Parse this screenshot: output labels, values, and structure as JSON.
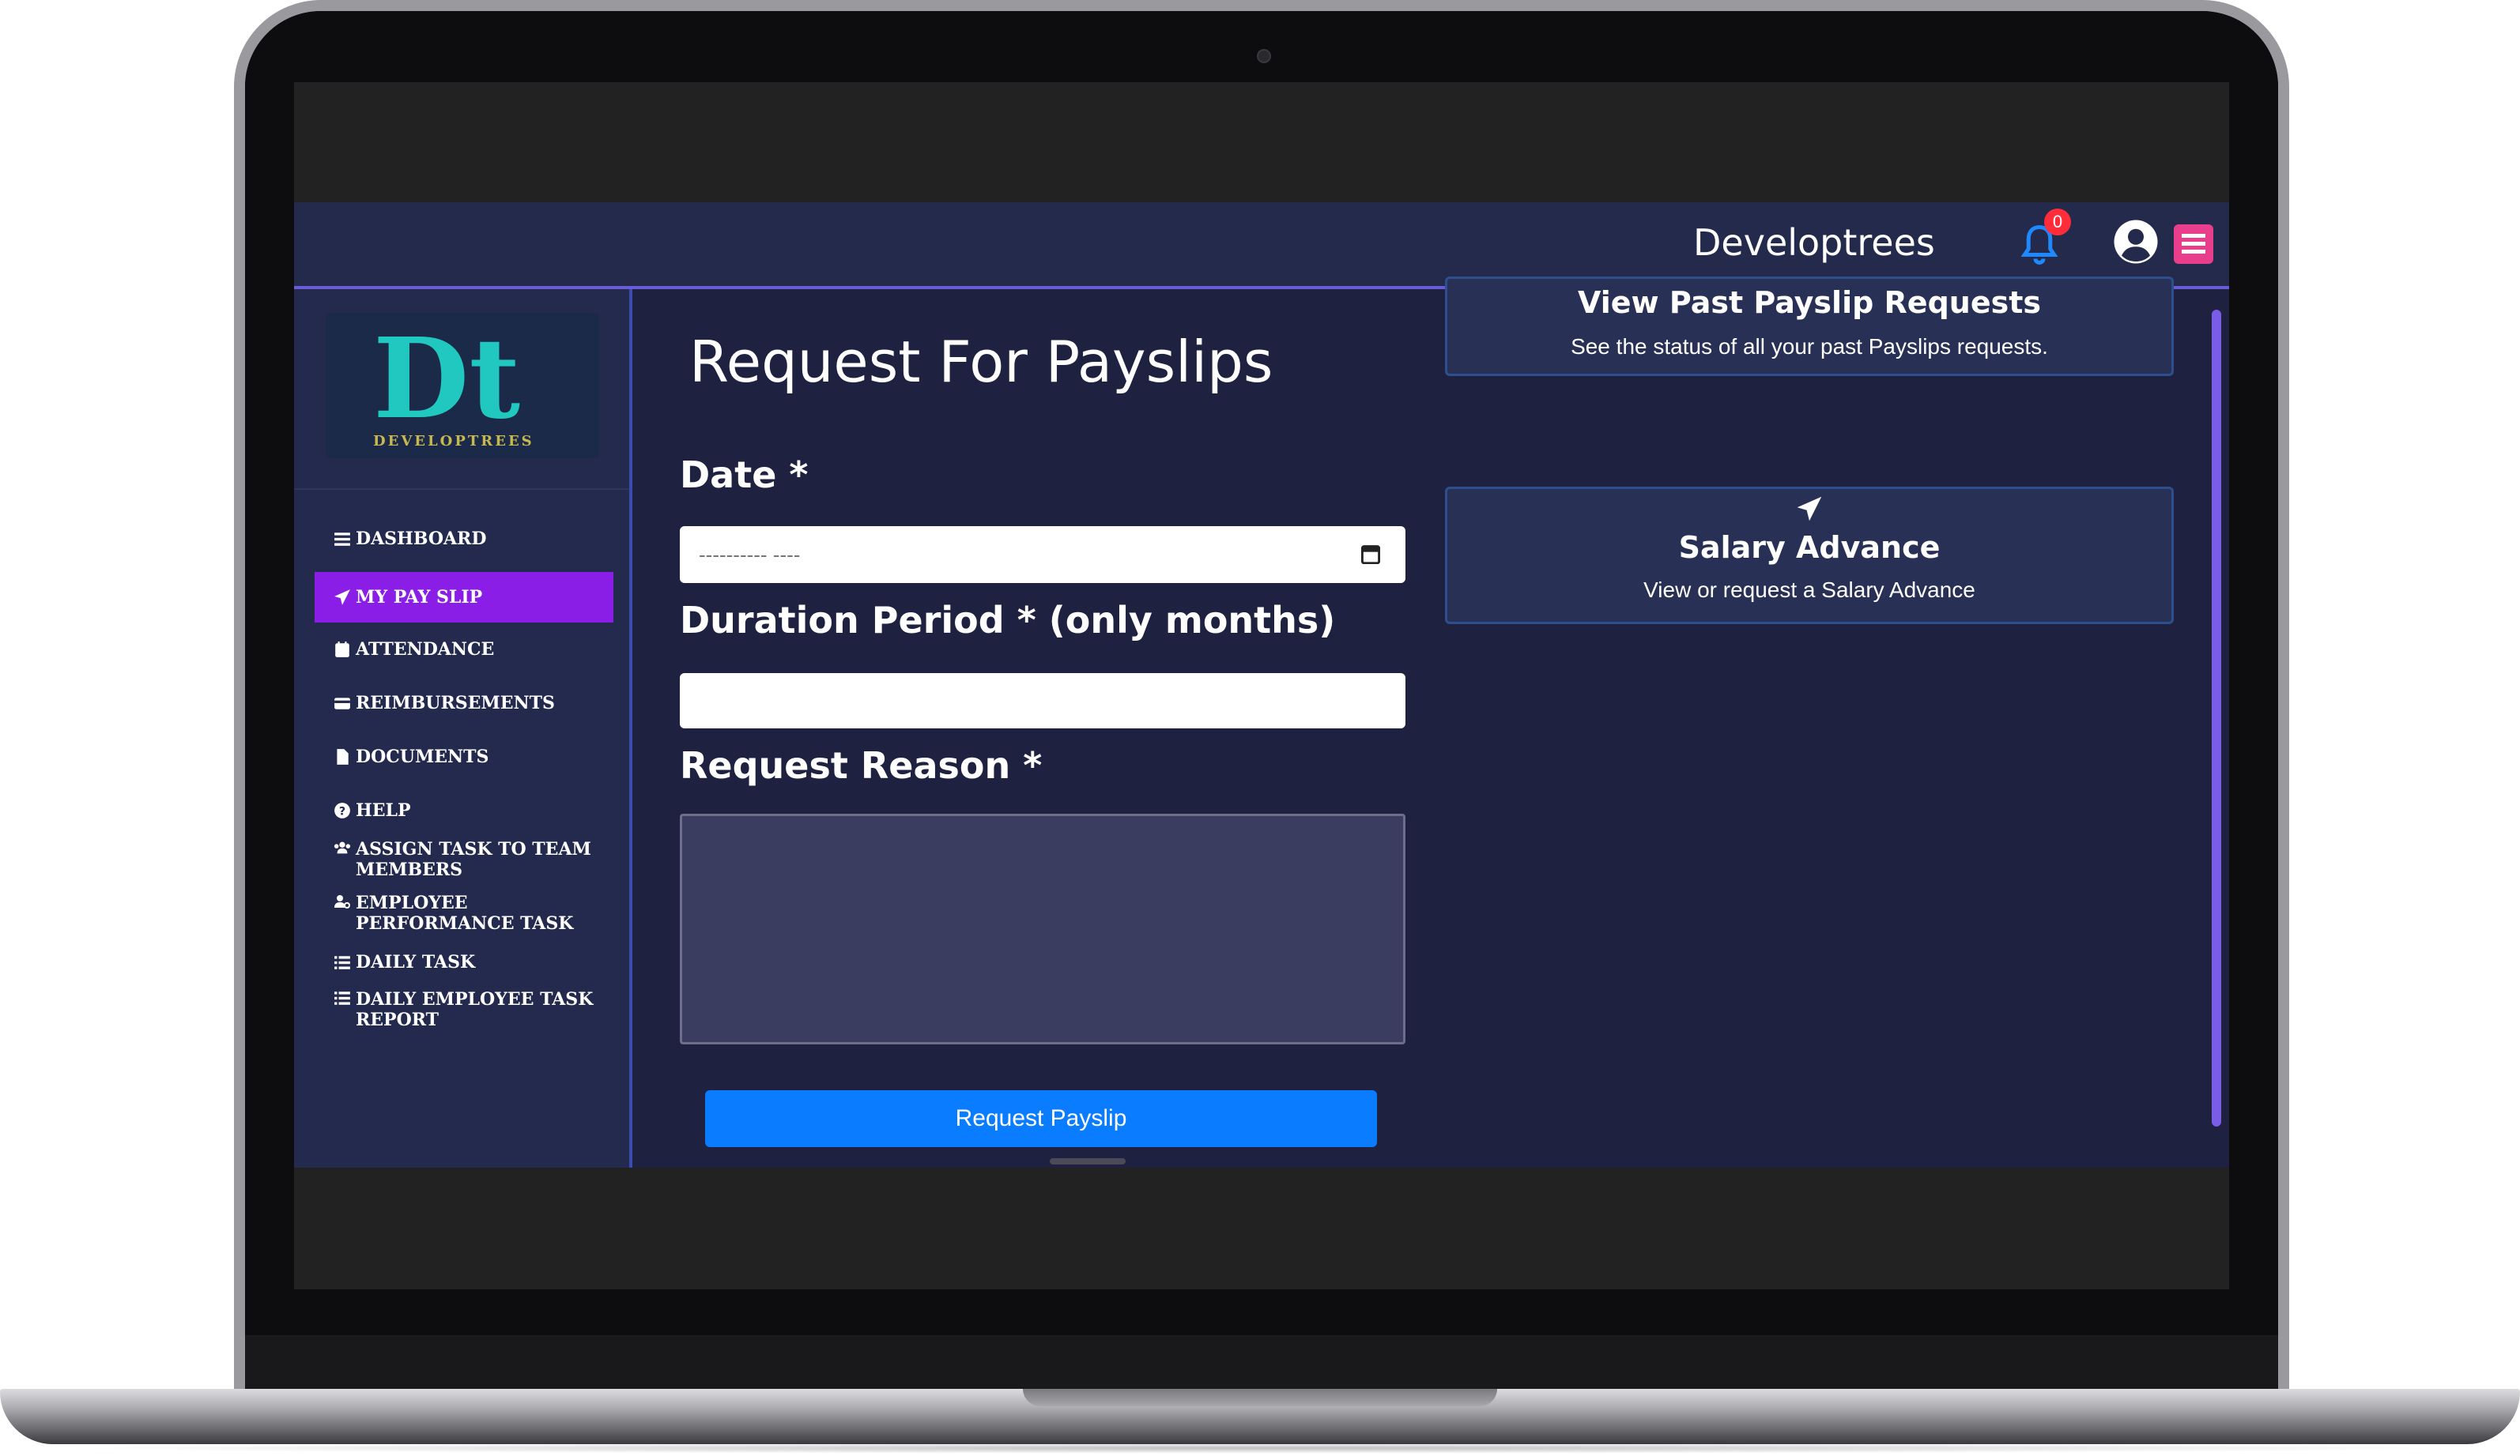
{
  "header": {
    "brand_name": "Developtrees",
    "notification_count": "0"
  },
  "logo": {
    "letters": "Dt",
    "wordmark": "DEVELOPTREES"
  },
  "sidebar": {
    "items": [
      {
        "label": "DASHBOARD",
        "icon": "list-icon"
      },
      {
        "label": "MY PAY SLIP",
        "icon": "paper-plane-icon",
        "active": true
      },
      {
        "label": "ATTENDANCE",
        "icon": "calendar-icon"
      },
      {
        "label": "REIMBURSEMENTS",
        "icon": "credit-card-icon"
      },
      {
        "label": "DOCUMENTS",
        "icon": "file-icon"
      },
      {
        "label": "HELP",
        "icon": "question-circle-icon"
      },
      {
        "label": "ASSIGN TASK TO TEAM MEMBERS",
        "icon": "users-icon"
      },
      {
        "label": "EMPLOYEE PERFORMANCE TASK",
        "icon": "user-gear-icon"
      },
      {
        "label": "DAILY TASK",
        "icon": "list-ul-icon"
      },
      {
        "label": "DAILY EMPLOYEE TASK REPORT",
        "icon": "list-ul-icon"
      }
    ]
  },
  "main": {
    "title": "Request For Payslips",
    "date_label": "Date *",
    "date_placeholder": "---------- ----",
    "duration_label": "Duration Period * (only months)",
    "duration_value": "",
    "reason_label": "Request Reason *",
    "reason_value": "",
    "submit_label": "Request Payslip"
  },
  "cards": {
    "past_requests": {
      "title": "View Past Payslip Requests",
      "subtitle": "See the status of all your past Payslips requests."
    },
    "salary_advance": {
      "title": "Salary Advance",
      "subtitle": "View or request a Salary Advance",
      "icon": "paper-plane-icon"
    }
  },
  "colors": {
    "active_nav": "#8a1ee6",
    "primary_button": "#0a7cff",
    "badge": "#ff2d3a",
    "menu_button": "#e83e8c"
  }
}
